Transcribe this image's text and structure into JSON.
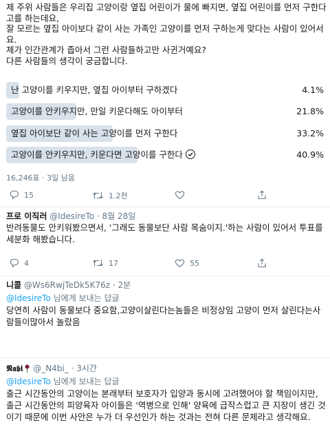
{
  "main_tweet": {
    "text": "제 주위 사람들은 우리집 고양이랑 옆집 어린이가 물에 빠지면, 옆집 어린이를 먼저 구한다고를 하는데요,\n잘 모르는 옆집 아이보다 같이 사는 가족인 고양이를 먼저 구하는게 맞다는 사람이 있어서요.\n제가 인간관계가 좁아서 그런 사람들하고만 사귄거예요?\n다른 사람들의 생각이 궁금합니다.",
    "poll": {
      "options": [
        {
          "label": "난 고양이를 키우지만, 옆집 아이부터 구하겠다",
          "percent": "4.1%",
          "value": 4.1
        },
        {
          "label": "고양이를 안키우지만, 만일 키운다해도 아이부터",
          "percent": "21.8%",
          "value": 21.8
        },
        {
          "label": "옆집 아이보단 같이 사는 고양이를 먼저 구한다",
          "percent": "33.2%",
          "value": 33.2
        },
        {
          "label": "고양이를 안키우지만, 키운다면 고양이를 구한다",
          "percent": "40.9%",
          "value": 40.9,
          "selected": true
        }
      ],
      "meta": "16,246표 · 3일 남음"
    },
    "actions": {
      "replies": "15",
      "retweets": "1.2천",
      "likes": ""
    }
  },
  "replies": [
    {
      "name": "프로 이직러",
      "handle": "@IdesireTo · 8월 28일",
      "body": "반려동물도 안키워봤으면서, '그래도 동물보단 사람 목숨이지.'하는 사람이 있어서 투표를 세분화 해봤습니다.",
      "actions": {
        "replies": "4",
        "retweets": "17",
        "likes": "55"
      }
    },
    {
      "name": "니콜",
      "handle": "@Ws6RwjTeDk5K76z · 2분",
      "replying_prefix": "@IdesireTo",
      "replying_suffix": " 님에게 보내는 답글",
      "body": "당연히 사람이 동물보다 중요함,고양이살린다는놈들은 비정상임 고양이 먼저 살린다는사람들이많아서 놀랐음"
    },
    {
      "name": "𝕹𝖆𝖇𝖎",
      "handle": "@_N4bi_ · 3시간",
      "replying_prefix": "@IdesireTo",
      "replying_suffix": " 님에게 보내는 답글",
      "body": "출근 시간동안의 고양이는 본래부터 보호자가 입양과 동시에 고려했어야 할 책임이지만, 출근 시간동안의 피양육자 아이들은 '역병으로 인해' 양육에 급작스럽고 큰 지장이 생긴 것이기 때문에 이번 사안은 누가 더 우선인가 하는 것과는 전혀 다른 문제라고 생각해요."
    }
  ],
  "colors": {
    "poll_bar": "#d9e2ea",
    "link": "#1da1f2",
    "muted": "#657786",
    "divider": "#e6ecf0"
  },
  "icons": [
    "reply-icon",
    "retweet-icon",
    "like-icon",
    "share-icon",
    "check-circle-icon",
    "rose-icon"
  ]
}
